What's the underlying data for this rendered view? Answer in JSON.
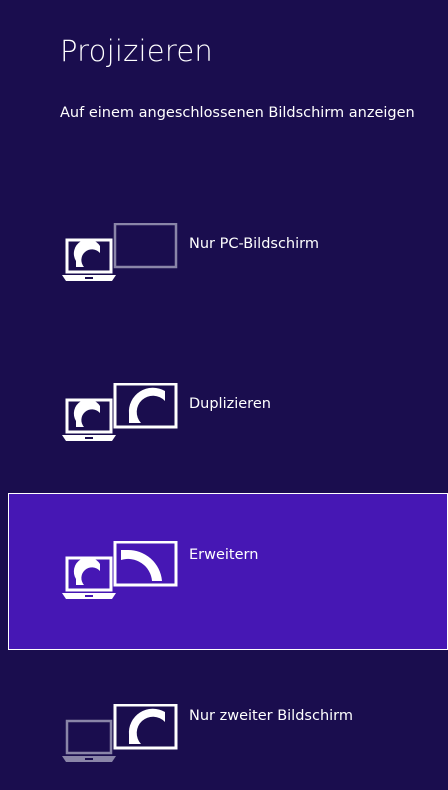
{
  "panel": {
    "title": "Projizieren",
    "subtitle": "Auf einem angeschlossenen Bildschirm anzeigen"
  },
  "options": [
    {
      "id": "pc-only",
      "label": "Nur PC-Bildschirm",
      "icon": "pc-screen-only-icon",
      "selected": false
    },
    {
      "id": "duplicate",
      "label": "Duplizieren",
      "icon": "duplicate-icon",
      "selected": false
    },
    {
      "id": "extend",
      "label": "Erweitern",
      "icon": "extend-icon",
      "selected": true
    },
    {
      "id": "second-only",
      "label": "Nur zweiter Bildschirm",
      "icon": "second-screen-only-icon",
      "selected": false
    }
  ],
  "colors": {
    "background": "#1a0d4e",
    "selected": "#4617b4",
    "foreground": "#ffffff",
    "inactive_stroke": "#8a85a8"
  }
}
